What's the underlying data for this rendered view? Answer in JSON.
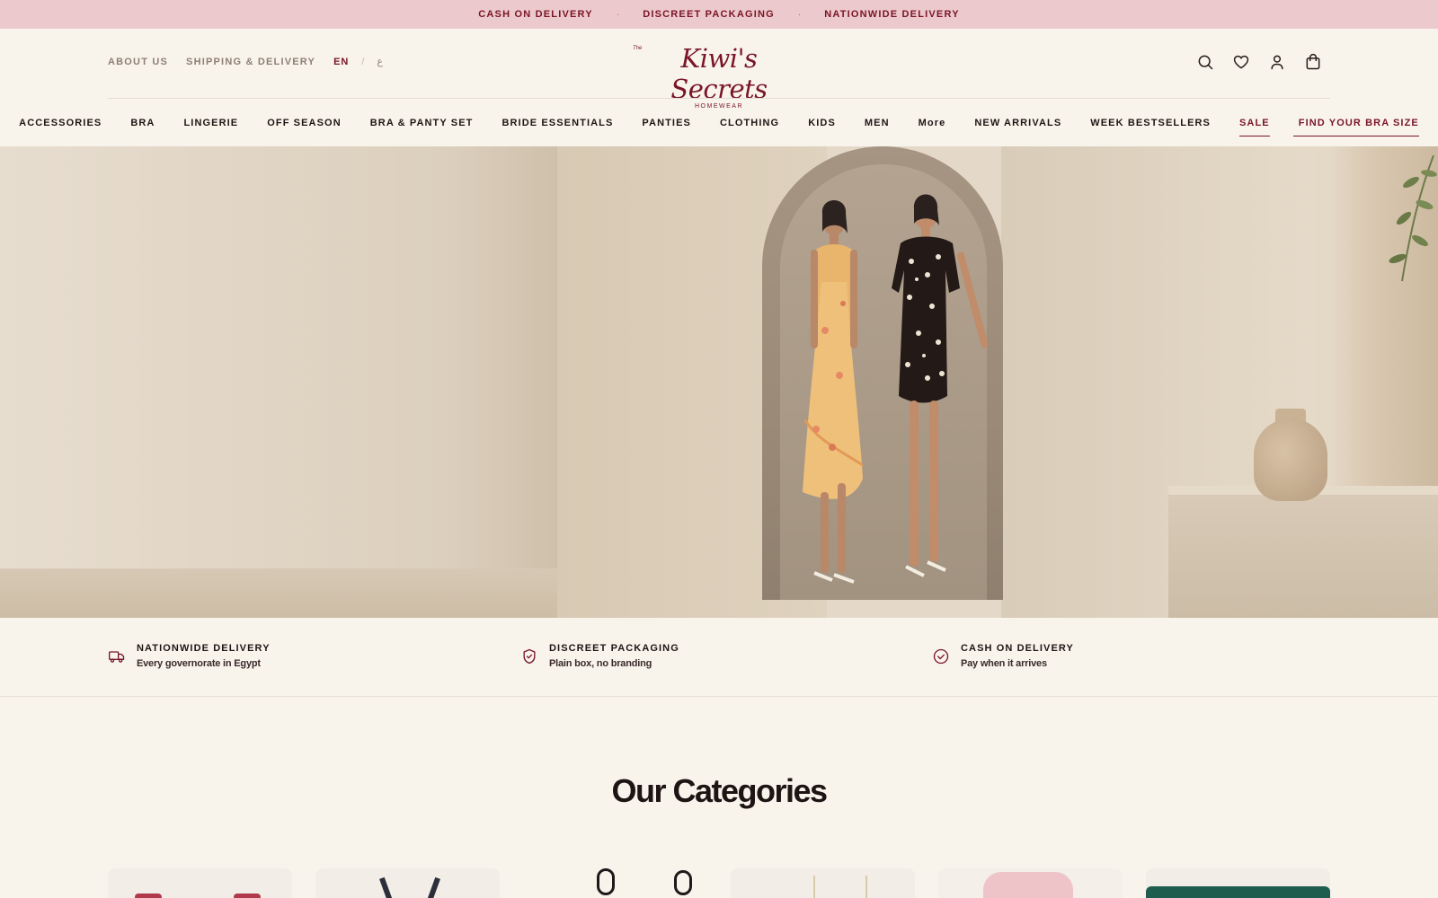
{
  "topbar": {
    "items": [
      "CASH ON DELIVERY",
      "DISCREET PACKAGING",
      "NATIONWIDE DELIVERY"
    ],
    "separator": "·"
  },
  "header": {
    "utility": {
      "about": "ABOUT US",
      "shipping": "SHIPPING & DELIVERY",
      "lang_en": "EN",
      "lang_sep": "/",
      "lang_ar": "ع"
    },
    "logo": {
      "prefix": "The",
      "brand": "Kiwi's Secrets",
      "sub": "HOMEWEAR"
    },
    "icons": [
      "search-icon",
      "heart-icon",
      "user-icon",
      "bag-icon"
    ]
  },
  "nav": {
    "items": [
      "ACCESSORIES",
      "BRA",
      "LINGERIE",
      "OFF SEASON",
      "BRA & PANTY SET",
      "BRIDE ESSENTIALS",
      "PANTIES",
      "CLOTHING",
      "KIDS",
      "MEN",
      "More",
      "NEW ARRIVALS",
      "WEEK BESTSELLERS",
      "SALE",
      "FIND YOUR BRA SIZE"
    ]
  },
  "hero": {
    "slides": 4,
    "active_slide": 1
  },
  "features": [
    {
      "icon": "truck-icon",
      "title": "NATIONWIDE DELIVERY",
      "desc": "Every governorate in Egypt"
    },
    {
      "icon": "shield-icon",
      "title": "DISCREET PACKAGING",
      "desc": "Plain box, no branding"
    },
    {
      "icon": "check-circle-icon",
      "title": "CASH ON DELIVERY",
      "desc": "Pay when it arrives"
    }
  ],
  "categories": {
    "title": "Our Categories"
  },
  "colors": {
    "accent": "#7a1527",
    "topbar_bg": "#ecc9cc",
    "page_bg": "#f8f4ec"
  }
}
